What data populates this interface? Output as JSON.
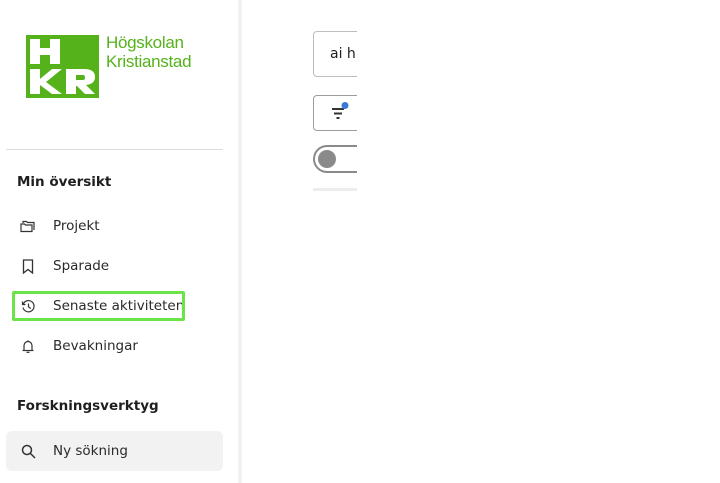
{
  "logo": {
    "mark_letters": [
      "H",
      "K",
      "R"
    ],
    "line1": "Högskolan",
    "line2": "Kristianstad",
    "brand_color": "#55b21b"
  },
  "sidebar": {
    "section1_title": "Min översikt",
    "items": [
      {
        "label": "Projekt",
        "icon": "folders-icon"
      },
      {
        "label": "Sparade",
        "icon": "bookmark-icon"
      },
      {
        "label": "Senaste aktiviteten",
        "icon": "history-icon",
        "highlighted": true
      },
      {
        "label": "Bevakningar",
        "icon": "bell-icon"
      }
    ],
    "section2_title": "Forskningsverktyg",
    "tools": [
      {
        "label": "Ny sökning",
        "icon": "search-icon",
        "active": true
      }
    ]
  },
  "main": {
    "search_value": "ai h",
    "filter_indicator_color": "#3a78d8",
    "toggle_on": false
  },
  "colors": {
    "highlight": "#6be44a",
    "active_bg": "#f2f2f2"
  }
}
